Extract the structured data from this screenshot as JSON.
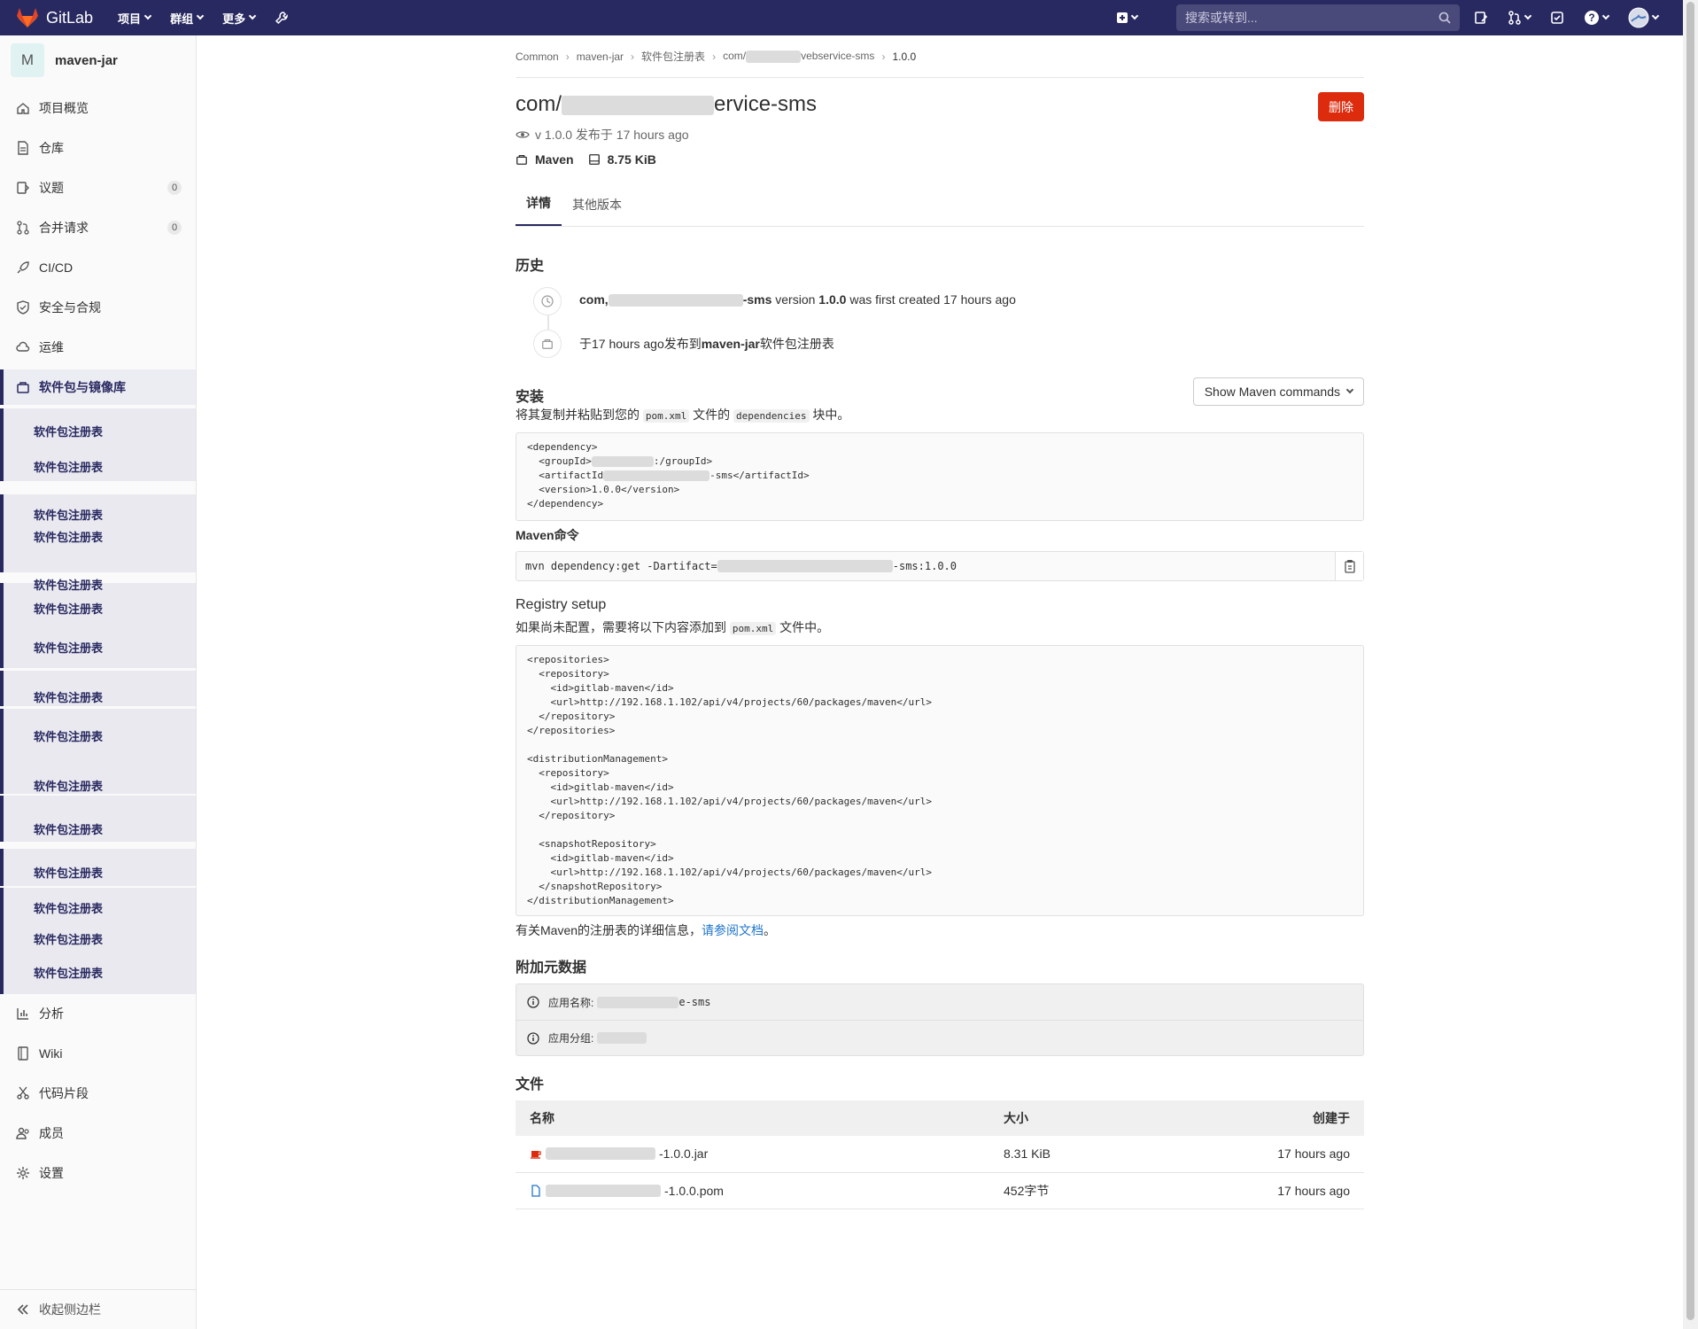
{
  "navbar": {
    "brand": "GitLab",
    "menu": [
      "项目",
      "群组",
      "更多"
    ],
    "search_placeholder": "搜索或转到..."
  },
  "sidebar": {
    "project_initial": "M",
    "project_name": "maven-jar",
    "items": [
      {
        "label": "项目概览",
        "icon": "home-icon"
      },
      {
        "label": "仓库",
        "icon": "doc-icon"
      },
      {
        "label": "议题",
        "icon": "issues-icon",
        "badge": "0"
      },
      {
        "label": "合并请求",
        "icon": "merge-request-icon",
        "badge": "0"
      },
      {
        "label": "CI/CD",
        "icon": "rocket-icon"
      },
      {
        "label": "安全与合规",
        "icon": "shield-icon"
      },
      {
        "label": "运维",
        "icon": "cloud-icon"
      },
      {
        "label": "软件包与镜像库",
        "icon": "package-icon"
      }
    ],
    "sub_label": "软件包注册表",
    "bottom_items": [
      {
        "label": "分析",
        "icon": "chart-icon"
      },
      {
        "label": "Wiki",
        "icon": "book-icon"
      },
      {
        "label": "代码片段",
        "icon": "scissors-icon"
      },
      {
        "label": "成员",
        "icon": "users-icon"
      },
      {
        "label": "设置",
        "icon": "gear-icon"
      }
    ],
    "collapse_label": "收起侧边栏"
  },
  "breadcrumb": {
    "items": [
      "Common",
      "maven-jar",
      "软件包注册表",
      "com/",
      "vebservice-sms"
    ],
    "current": "1.0.0"
  },
  "package": {
    "title_prefix": "com/",
    "title_suffix": "ervice-sms",
    "delete_label": "删除",
    "version_line": "v 1.0.0 发布于 17 hours ago",
    "type": "Maven",
    "size": "8.75 KiB"
  },
  "tabs": [
    "详情",
    "其他版本"
  ],
  "history": {
    "heading": "历史",
    "entry1": {
      "prefix": "com,",
      "name_suffix": "-sms",
      "version_label": "version",
      "version": "1.0.0",
      "tail": "was first created 17 hours ago"
    },
    "entry2": {
      "prefix": "于17 hours ago发布到",
      "project": "maven-jar",
      "suffix": "软件包注册表"
    }
  },
  "install": {
    "heading": "安装",
    "dropdown": "Show Maven commands",
    "desc_prefix": "将其复制并粘贴到您的",
    "desc_code1": "pom.xml",
    "desc_mid": "文件的",
    "desc_code2": "dependencies",
    "desc_suffix": "块中。",
    "dependency_xml": "<dependency>\n  <groupId>\n  <artifactId\n  <version>1.0.0\n</dependency>",
    "dep_lines": {
      "l1": "<dependency>",
      "l2_pre": "  <groupId>",
      "l2_post": ":/groupId>",
      "l3_pre": "  <artifactId",
      "l3_post": "-sms</artifactId>",
      "l4": "  <version>1.0.0</version>",
      "l5": "</dependency>"
    },
    "cmd_heading": "Maven命令",
    "cmd_prefix": "mvn dependency:get -Dartifact=",
    "cmd_suffix": "-sms:1.0.0"
  },
  "registry": {
    "heading": "Registry setup",
    "desc_prefix": "如果尚未配置，需要将以下内容添加到",
    "desc_code": "pom.xml",
    "desc_suffix": "文件中。",
    "xml": "<repositories>\n  <repository>\n    <id>gitlab-maven</id>\n    <url>http://192.168.1.102/api/v4/projects/60/packages/maven</url>\n  </repository>\n</repositories>\n\n<distributionManagement>\n  <repository>\n    <id>gitlab-maven</id>\n    <url>http://192.168.1.102/api/v4/projects/60/packages/maven</url>\n  </repository>\n\n  <snapshotRepository>\n    <id>gitlab-maven</id>\n    <url>http://192.168.1.102/api/v4/projects/60/packages/maven</url>\n  </snapshotRepository>\n</distributionManagement>",
    "docs_prefix": "有关Maven的注册表的详细信息，",
    "docs_link": "请参阅文档",
    "docs_suffix": "。"
  },
  "metadata": {
    "heading": "附加元数据",
    "rows": [
      {
        "label": "应用名称:",
        "suffix": "e-sms"
      },
      {
        "label": "应用分组:",
        "suffix": ""
      }
    ]
  },
  "files": {
    "heading": "文件",
    "columns": [
      "名称",
      "大小",
      "创建于"
    ],
    "rows": [
      {
        "name_suffix": "-1.0.0.jar",
        "size": "8.31 KiB",
        "created": "17 hours ago",
        "icon": "jar-icon"
      },
      {
        "name_suffix": "-1.0.0.pom",
        "size": "452字节",
        "created": "17 hours ago",
        "icon": "file-icon"
      }
    ]
  },
  "colors": {
    "navbar": "#292961",
    "danger": "#dd2b0e",
    "link": "#1f75cb"
  }
}
